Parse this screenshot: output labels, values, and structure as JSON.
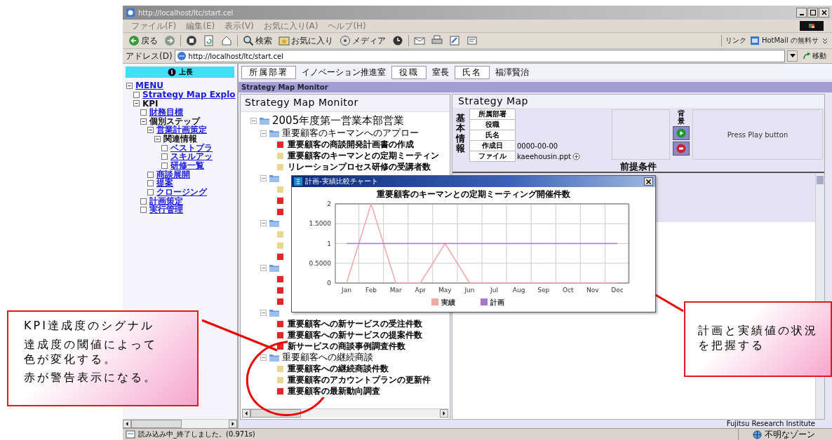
{
  "browser": {
    "title": "http://localhost/ltc/start.cel",
    "menu": [
      "ファイル(F)",
      "編集(E)",
      "表示(V)",
      "お気に入り(A)",
      "ヘルプ(H)"
    ],
    "toolbar": [
      {
        "kind": "back",
        "label": "戻る"
      },
      {
        "kind": "forward"
      },
      {
        "kind": "stop"
      },
      {
        "kind": "refresh"
      },
      {
        "kind": "home"
      },
      {
        "kind": "search",
        "label": "検索"
      },
      {
        "kind": "favorites",
        "label": "お気に入り"
      },
      {
        "kind": "media",
        "label": "メディア"
      },
      {
        "kind": "history"
      },
      {
        "kind": "mail"
      },
      {
        "kind": "print"
      },
      {
        "kind": "edit"
      },
      {
        "kind": "discuss"
      }
    ],
    "links_label": "リンク",
    "link": "HotMail の無料サ",
    "address_label": "アドレス(D)",
    "address": "http://localhost/ltc/start.cel",
    "go": "移動"
  },
  "header": {
    "boss_button": "上長",
    "fields": [
      {
        "label": "所属部署",
        "value": "イノベーション推進室"
      },
      {
        "label": "役職",
        "value": "室長"
      },
      {
        "label": "氏名",
        "value": "福澤賢治"
      }
    ]
  },
  "banner": "Strategy Map Monitor",
  "sidebar": {
    "items": [
      {
        "label": "MENU",
        "kind": "link",
        "expanded": true,
        "children": [
          {
            "label": "Strategy Map Explo",
            "kind": "link"
          },
          {
            "label": "KPI",
            "kind": "label",
            "expanded": true,
            "children": [
              {
                "label": "財務目標",
                "kind": "link"
              },
              {
                "label": "個別ステップ",
                "kind": "label",
                "expanded": true,
                "children": [
                  {
                    "label": "営業計画策定",
                    "kind": "link",
                    "expanded": true,
                    "children": [
                      {
                        "label": "関連情報",
                        "kind": "label",
                        "expanded": true,
                        "children": [
                          {
                            "label": "ベストプラ",
                            "kind": "link"
                          },
                          {
                            "label": "スキルアッ",
                            "kind": "link"
                          },
                          {
                            "label": "研修一覧",
                            "kind": "link"
                          }
                        ]
                      }
                    ]
                  },
                  {
                    "label": "商談展開",
                    "kind": "link"
                  },
                  {
                    "label": "提案",
                    "kind": "link"
                  },
                  {
                    "label": "クロージング",
                    "kind": "link"
                  }
                ]
              },
              {
                "label": "計画策定",
                "kind": "link"
              },
              {
                "label": "実行管理",
                "kind": "link"
              }
            ]
          }
        ]
      }
    ]
  },
  "monitor": {
    "title": "Strategy Map Monitor",
    "tree": [
      {
        "kind": "root",
        "label": "2005年度第一営業本部営業",
        "expanded": true,
        "children": [
          {
            "kind": "group",
            "label": "重要顧客のキーマンへのアプロー",
            "expanded": true,
            "children": [
              {
                "kind": "item",
                "color": "#e02828",
                "label": "重要顧客の商談開発計画書の作成"
              },
              {
                "kind": "item",
                "color": "#e8d890",
                "label": "重要顧客のキーマンとの定期ミーティン"
              },
              {
                "kind": "item",
                "color": "#e8d890",
                "label": "リレーションプロセス研修の受講者数"
              }
            ]
          },
          {
            "kind": "group",
            "expanded": true,
            "children": [
              {
                "kind": "item",
                "color": "#e8d890"
              },
              {
                "kind": "item",
                "color": "#e02828"
              },
              {
                "kind": "item",
                "color": "#e02828"
              }
            ]
          },
          {
            "kind": "group",
            "expanded": true,
            "children": [
              {
                "kind": "item",
                "color": "#e8d890"
              },
              {
                "kind": "item",
                "color": "#e8d890"
              },
              {
                "kind": "item",
                "color": "#e02828"
              }
            ]
          },
          {
            "kind": "group",
            "expanded": true,
            "children": [
              {
                "kind": "item",
                "color": "#e02828"
              },
              {
                "kind": "item",
                "color": "#e02828"
              },
              {
                "kind": "item",
                "color": "#e02828"
              }
            ]
          },
          {
            "kind": "group",
            "expanded": true,
            "children": [
              {
                "kind": "item",
                "color": "#e02828",
                "label": "重要顧客への新サービスの受注件数"
              },
              {
                "kind": "item",
                "color": "#e02828",
                "label": "重要顧客への新サービスの提案件数"
              },
              {
                "kind": "item",
                "color": "#e02828",
                "label": "新サービスの商談事例調査件数"
              }
            ]
          },
          {
            "kind": "group",
            "label": "重要顧客への継続商談",
            "expanded": true,
            "children": [
              {
                "kind": "item",
                "color": "#e8d890",
                "label": "重要顧客への継続商談件数"
              },
              {
                "kind": "item",
                "color": "#e8d890",
                "label": "重要顧客のアカウントプランの更新件"
              },
              {
                "kind": "item",
                "color": "#e02828",
                "label": "重要顧客の最新動向調査"
              }
            ]
          }
        ]
      }
    ]
  },
  "strategy_map": {
    "title": "Strategy Map",
    "info_label": "基本情報",
    "info": [
      {
        "label": "所属部署"
      },
      {
        "label": "役職"
      },
      {
        "label": "氏名"
      },
      {
        "label": "作成日",
        "value": "0000-00-00"
      },
      {
        "label": "ファイル",
        "value": "kaeehousin.ppt"
      }
    ],
    "background_label": "背景",
    "play_message": "Press Play button",
    "premise_label": "前提条件"
  },
  "chart_window": {
    "title": "計画-実績比較チャート",
    "chart_data": {
      "type": "line",
      "title": "重要顧客のキーマンとの定期ミーティング開催件数",
      "categories": [
        "Jan",
        "Feb",
        "Mar",
        "Apr",
        "May",
        "Jun",
        "Jul",
        "Aug",
        "Sep",
        "Oct",
        "Nov",
        "Dec"
      ],
      "series": [
        {
          "name": "実績",
          "color": "#f2a6a6",
          "values": [
            0,
            2,
            0,
            0,
            1,
            0,
            0,
            0,
            0,
            0,
            0,
            0
          ]
        },
        {
          "name": "計画",
          "color": "#a878c8",
          "values": [
            1,
            1,
            1,
            1,
            1,
            1,
            1,
            1,
            1,
            1,
            1,
            1
          ]
        }
      ],
      "grid": true,
      "legend": true,
      "ylim": [
        0,
        2
      ],
      "yticks": [
        0,
        {
          "value": 0.5,
          "label": "0.5000"
        },
        1,
        {
          "value": 1.5,
          "label": "1.5000"
        },
        2
      ]
    }
  },
  "footer": "Fujitsu Research Institute",
  "status_bar": {
    "text": "読み込み中_終了しました。(0.971s)",
    "zone": "不明なゾーン"
  },
  "annotations": [
    {
      "kind": "callout",
      "lines": [
        "KPI達成度のシグナル",
        "達成度の閾値によって色が変化する。",
        "赤が警告表示になる。"
      ]
    },
    {
      "kind": "callout",
      "lines": [
        "計画と実績値の状況を把握する"
      ]
    }
  ]
}
